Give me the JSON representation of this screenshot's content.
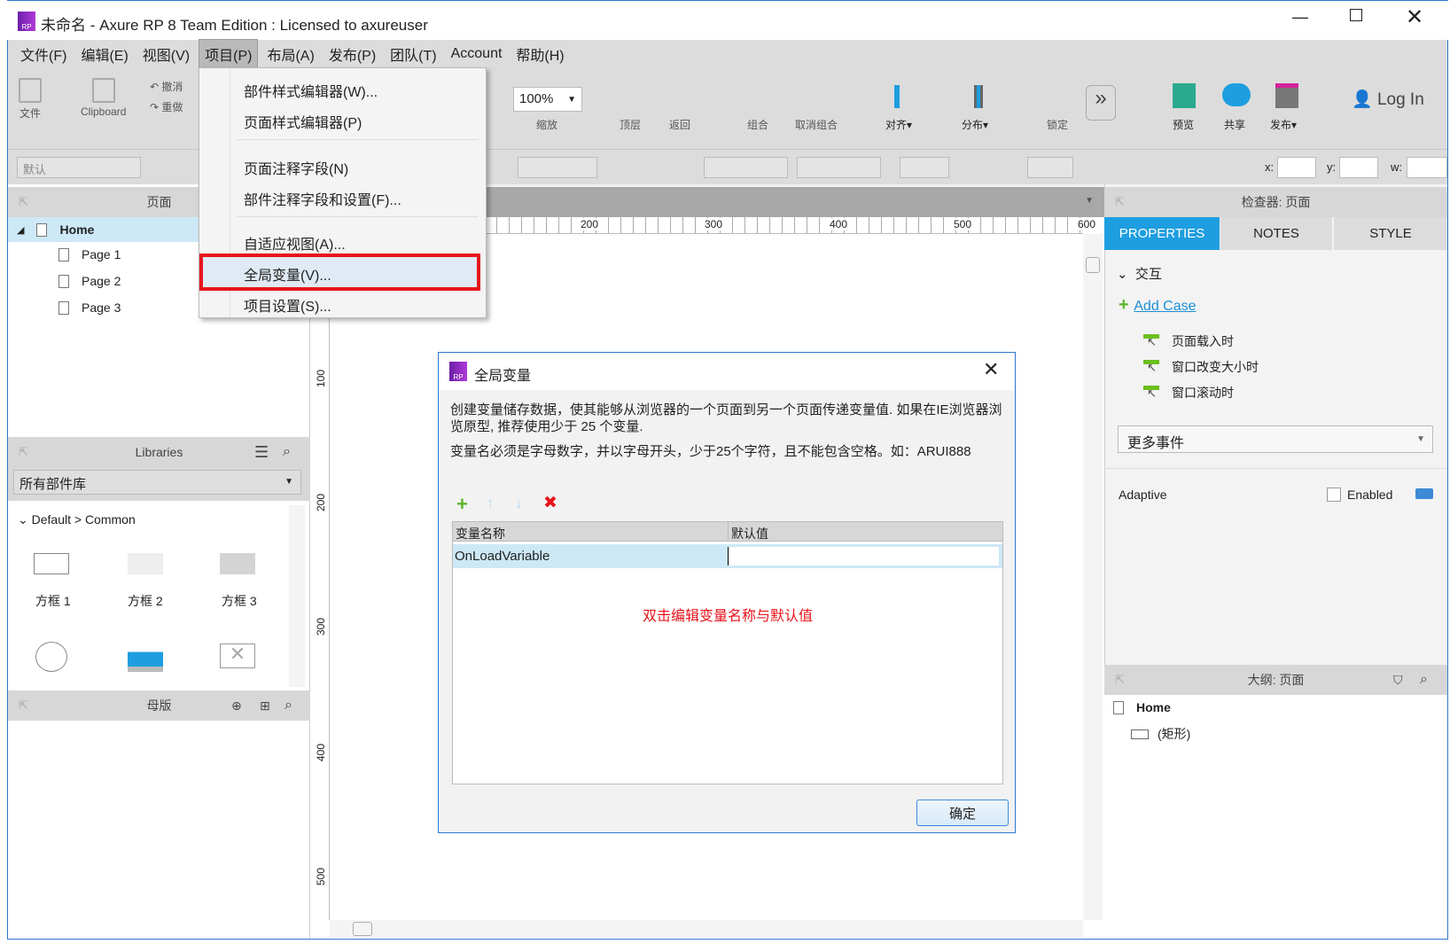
{
  "window": {
    "title": "未命名 - Axure RP 8 Team Edition : Licensed to axureuser",
    "logo": "RP",
    "controls": [
      "minimize-icon",
      "maximize-icon",
      "close-icon"
    ]
  },
  "menubar": [
    "文件(F)",
    "编辑(E)",
    "视图(V)",
    "项目(P)",
    "布局(A)",
    "发布(P)",
    "团队(T)",
    "Account",
    "帮助(H)"
  ],
  "toolbar": {
    "file": "文件",
    "clipboard": "Clipboard",
    "undo": "撤消",
    "redo": "重做",
    "zoom_value": "100%",
    "zoom_label": "缩放",
    "top": "顶层",
    "back": "返回",
    "group": "组合",
    "ungroup": "取消组合",
    "align": "对齐▾",
    "distribute": "分布▾",
    "lock": "锁定",
    "more": "»",
    "preview": "预览",
    "share": "共享",
    "publish": "发布▾",
    "login": "Log In"
  },
  "format_bar": {
    "style_value": "默认",
    "x_label": "x:",
    "y_label": "y:",
    "w_label": "w:"
  },
  "pages_panel": {
    "title": "页面",
    "items": [
      "Home",
      "Page 1",
      "Page 2",
      "Page 3"
    ]
  },
  "libraries_panel": {
    "title": "Libraries",
    "dropdown": "所有部件库",
    "group": "Default > Common",
    "widgets": [
      "方框 1",
      "方框 2",
      "方框 3"
    ]
  },
  "masters_panel": {
    "title": "母版"
  },
  "ruler": {
    "h": [
      "200",
      "300",
      "400",
      "500",
      "600"
    ],
    "v": [
      "100",
      "200",
      "300",
      "400",
      "500"
    ]
  },
  "project_menu": {
    "items": [
      "部件样式编辑器(W)...",
      "页面样式编辑器(P)",
      "页面注释字段(N)",
      "部件注释字段和设置(F)...",
      "自适应视图(A)...",
      "全局变量(V)...",
      "项目设置(S)..."
    ],
    "highlighted": "全局变量(V)...",
    "highlight_color": "#e8141b"
  },
  "dialog": {
    "title": "全局变量",
    "desc1": "创建变量储存数据，使其能够从浏览器的一个页面到另一个页面传递变量值. 如果在IE浏览器浏览原型, 推荐使用少于 25 个变量.",
    "desc2": "变量名必须是字母数字，并以字母开头，少于25个字符，且不能包含空格。如：ARUI888",
    "columns": [
      "变量名称",
      "默认值"
    ],
    "rows": [
      {
        "name": "OnLoadVariable",
        "value": ""
      }
    ],
    "hint": "双击编辑变量名称与默认值",
    "ok": "确定"
  },
  "inspector": {
    "title": "检查器: 页面",
    "tabs": [
      "PROPERTIES",
      "NOTES",
      "STYLE"
    ],
    "active_tab": "PROPERTIES",
    "section": "交互",
    "add_case": "Add Case",
    "events": [
      "页面载入时",
      "窗口改变大小时",
      "窗口滚动时"
    ],
    "more_events": "更多事件",
    "adaptive": "Adaptive",
    "enabled": "Enabled",
    "enabled_checked": false
  },
  "outline": {
    "title": "大纲: 页面",
    "items": [
      "Home",
      "(矩形)"
    ]
  },
  "colors": {
    "accent": "#1e9ee0",
    "menu_highlight": "#e8141b"
  }
}
